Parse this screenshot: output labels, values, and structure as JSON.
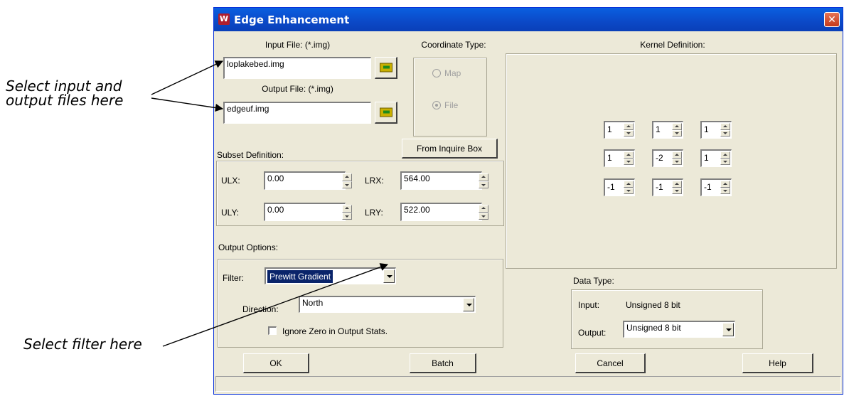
{
  "annotations": {
    "input_output": [
      "Select input and",
      "output files here"
    ],
    "filter": "Select filter here"
  },
  "dialog": {
    "title": "Edge Enhancement",
    "app_icon": "W"
  },
  "input_file": {
    "label": "Input File: (*.img)",
    "value": "loplakebed.img",
    "browse_icon": "folder-icon"
  },
  "output_file": {
    "label": "Output File: (*.img)",
    "value": "edgeuf.img",
    "browse_icon": "folder-icon"
  },
  "coordinate_type": {
    "label": "Coordinate Type:",
    "options": [
      {
        "label": "Map",
        "checked": false
      },
      {
        "label": "File",
        "checked": true
      }
    ]
  },
  "subset": {
    "label": "Subset Definition:",
    "from_inquire_label": "From Inquire Box",
    "ulx_label": "ULX:",
    "ulx_value": "0.00",
    "uly_label": "ULY:",
    "uly_value": "0.00",
    "lrx_label": "LRX:",
    "lrx_value": "564.00",
    "lry_label": "LRY:",
    "lry_value": "522.00"
  },
  "kernel": {
    "label": "Kernel Definition:",
    "rows": [
      [
        "1",
        "1",
        "1"
      ],
      [
        "1",
        "-2",
        "1"
      ],
      [
        "-1",
        "-1",
        "-1"
      ]
    ]
  },
  "output_options": {
    "label": "Output Options:",
    "filter_label": "Filter:",
    "filter_value": "Prewitt Gradient",
    "direction_label": "Direction:",
    "direction_value": "North",
    "ignore_zero_label": "Ignore Zero in Output Stats.",
    "ignore_zero_checked": false
  },
  "data_type": {
    "label": "Data Type:",
    "input_label": "Input:",
    "input_value": "Unsigned 8 bit",
    "output_label": "Output:",
    "output_value": "Unsigned 8 bit"
  },
  "buttons": {
    "ok": "OK",
    "batch": "Batch",
    "cancel": "Cancel",
    "help": "Help"
  },
  "colors": {
    "title_bar": "#0b49c7",
    "dialog_bg": "#ece9d8",
    "selection": "#0a246a"
  }
}
